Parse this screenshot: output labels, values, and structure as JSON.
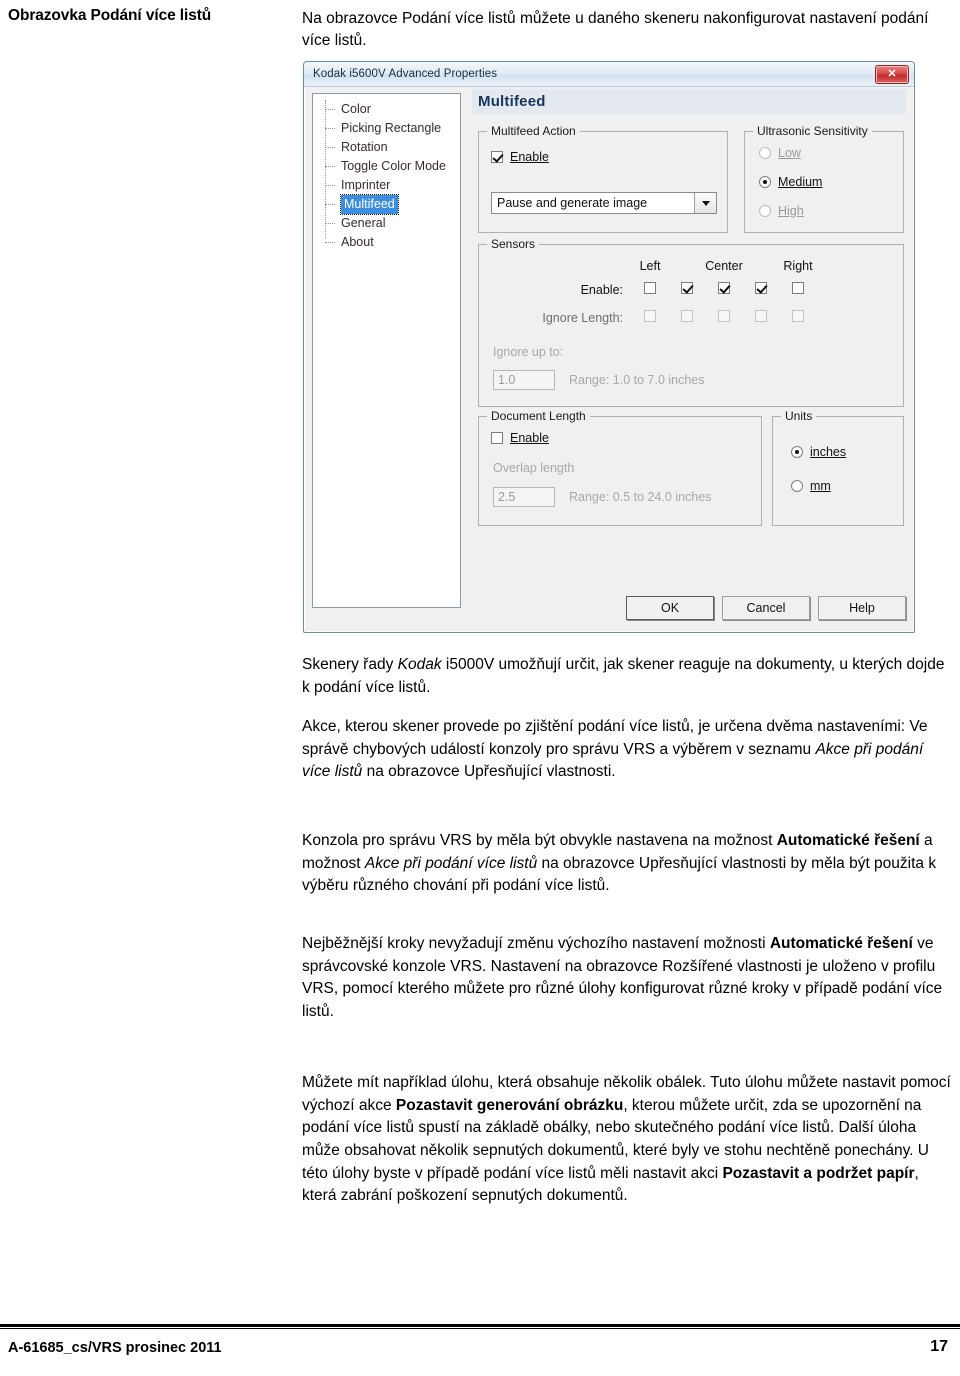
{
  "page": {
    "heading": "Obrazovka Podání více listů",
    "intro": "Na obrazovce Podání více listů můžete u daného skeneru nakonfigurovat nastavení podání více listů."
  },
  "dialog": {
    "title": "Kodak i5600V Advanced Properties",
    "close_icon": "close-icon",
    "close_glyph": "✕",
    "tree": {
      "items": [
        {
          "label": "Color",
          "selected": false
        },
        {
          "label": "Picking Rectangle",
          "selected": false
        },
        {
          "label": "Rotation",
          "selected": false
        },
        {
          "label": "Toggle Color Mode",
          "selected": false
        },
        {
          "label": "Imprinter",
          "selected": false
        },
        {
          "label": "Multifeed",
          "selected": true
        },
        {
          "label": "General",
          "selected": false
        },
        {
          "label": "About",
          "selected": false
        }
      ]
    },
    "pane_title": "Multifeed",
    "multifeed_action": {
      "legend": "Multifeed Action",
      "enable_label": "Enable",
      "enable_checked": true,
      "combo_value": "Pause and generate image"
    },
    "ultrasonic": {
      "legend": "Ultrasonic Sensitivity",
      "options": [
        {
          "label": "Low",
          "selected": false
        },
        {
          "label": "Medium",
          "selected": true
        },
        {
          "label": "High",
          "selected": false
        }
      ]
    },
    "sensors": {
      "legend": "Sensors",
      "columns": [
        "Left",
        "Center",
        "Right"
      ],
      "enable_label": "Enable:",
      "ignore_length_label": "Ignore Length:",
      "enable_values": [
        false,
        true,
        true,
        true,
        false
      ],
      "ignore_length_values": [
        false,
        false,
        false,
        false,
        false
      ],
      "ignore_up_to_label": "Ignore up to:",
      "ignore_up_to_value": "1.0",
      "ignore_range_text": "Range: 1.0 to 7.0 inches"
    },
    "document_length": {
      "legend": "Document Length",
      "enable_label": "Enable",
      "enable_checked": false,
      "overlap_label": "Overlap length",
      "overlap_value": "2.5",
      "overlap_range_text": "Range: 0.5 to 24.0 inches"
    },
    "units": {
      "legend": "Units",
      "options": [
        {
          "label": "inches",
          "selected": true
        },
        {
          "label": "mm",
          "selected": false
        }
      ]
    },
    "buttons": {
      "ok": "OK",
      "cancel": "Cancel",
      "help": "Help"
    }
  },
  "body": {
    "p1_a": "Skenery řady ",
    "p1_i": "Kodak",
    "p1_b": " i5000V umožňují určit, jak skener reaguje na dokumenty, u kterých dojde k podání více listů.",
    "p2_a": "Akce, kterou skener provede po zjištění podání více listů, je určena dvěma nastaveními: Ve správě chybových událostí konzoly pro správu VRS a výběrem v seznamu ",
    "p2_i": "Akce při podání více listů",
    "p2_b": " na obrazovce Upřesňující vlastnosti.",
    "p3_a": "Konzola pro správu VRS by měla být obvykle nastavena na možnost ",
    "p3_b1": "Automatické řešení",
    "p3_b": " a možnost ",
    "p3_i": "Akce při podání více listů",
    "p3_c": " na obrazovce Upřesňující vlastnosti by měla být použita k výběru různého chování při podání více listů.",
    "p4_a": "Nejběžnější kroky nevyžadují změnu výchozího nastavení možnosti ",
    "p4_b1": "Automatické řešení",
    "p4_c": " ve správcovské konzole VRS. Nastavení na obrazovce Rozšířené vlastnosti je uloženo v profilu VRS, pomocí kterého můžete pro různé úlohy konfigurovat různé kroky v případě podání více listů.",
    "p5_a": "Můžete mít například úlohu, která obsahuje několik obálek. Tuto úlohu můžete nastavit pomocí výchozí akce ",
    "p5_b1": "Pozastavit generování obrázku",
    "p5_b": ", kterou můžete určit, zda se upozornění na podání více listů spustí na základě obálky, nebo skutečného podání více listů. Další úloha může obsahovat několik sepnutých dokumentů, které byly ve stohu nechtěně ponechány. U této úlohy byste v případě podání více listů měli nastavit akci ",
    "p5_b2": "Pozastavit a podržet papír",
    "p5_c": ", která zabrání poškození sepnutých dokumentů."
  },
  "footer": {
    "left": "A-61685_cs/VRS  prosinec 2011",
    "page_number": "17"
  }
}
